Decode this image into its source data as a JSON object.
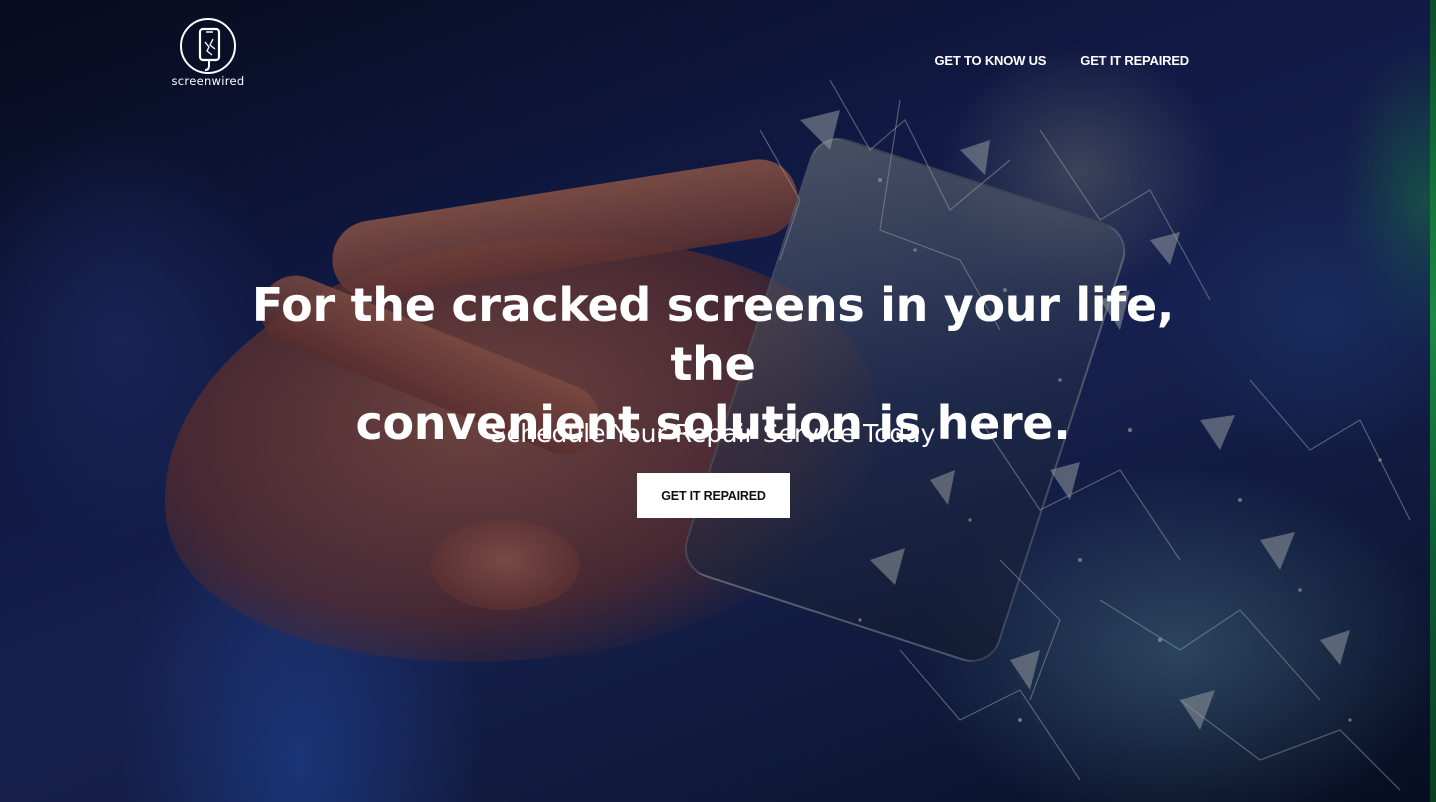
{
  "brand": {
    "name": "screenwired",
    "logo_icon": "phone-in-circle-icon"
  },
  "nav": {
    "items": [
      {
        "label": "GET TO KNOW US"
      },
      {
        "label": "GET IT REPAIRED"
      }
    ]
  },
  "hero": {
    "headline_line1": "For the cracked screens in your life, the",
    "headline_line2": "convenient solution is here.",
    "subheadline": "Schedule Your Repair Service Today",
    "cta_label": "GET IT REPAIRED",
    "background_image": "hand-holding-shattering-phone-photo"
  },
  "colors": {
    "text": "#ffffff",
    "button_bg": "#ffffff",
    "button_text": "#111111",
    "overlay": "#000000"
  }
}
